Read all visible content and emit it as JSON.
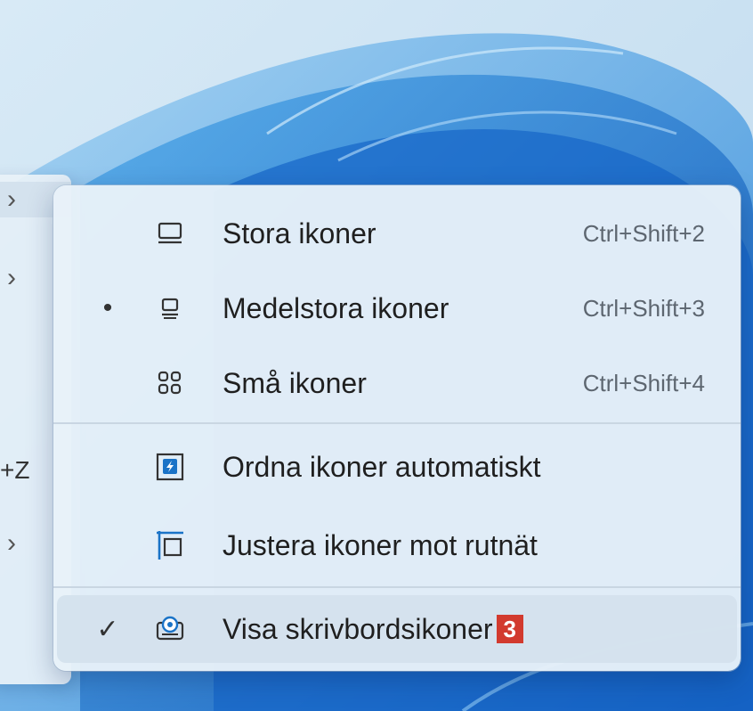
{
  "parent_menu": {
    "items": [
      {
        "type": "submenu"
      },
      {
        "type": "submenu"
      },
      {
        "type": "shortcut",
        "shortcut_text": "+Z"
      },
      {
        "type": "submenu"
      }
    ]
  },
  "submenu": {
    "items": [
      {
        "label": "Stora ikoner",
        "shortcut": "Ctrl+Shift+2",
        "icon": "large-icons-icon",
        "mark": ""
      },
      {
        "label": "Medelstora ikoner",
        "shortcut": "Ctrl+Shift+3",
        "icon": "medium-icons-icon",
        "mark": "•"
      },
      {
        "label": "Små ikoner",
        "shortcut": "Ctrl+Shift+4",
        "icon": "small-icons-icon",
        "mark": ""
      },
      {
        "label": "Ordna ikoner automatiskt",
        "shortcut": "",
        "icon": "auto-arrange-icon",
        "mark": ""
      },
      {
        "label": "Justera ikoner mot rutnät",
        "shortcut": "",
        "icon": "align-grid-icon",
        "mark": ""
      },
      {
        "label": "Visa skrivbordsikoner",
        "shortcut": "",
        "icon": "show-desktop-icons-icon",
        "mark": "✓",
        "badge": "3"
      }
    ]
  },
  "colors": {
    "accent": "#1a73c7",
    "badge": "#d23a2e"
  }
}
